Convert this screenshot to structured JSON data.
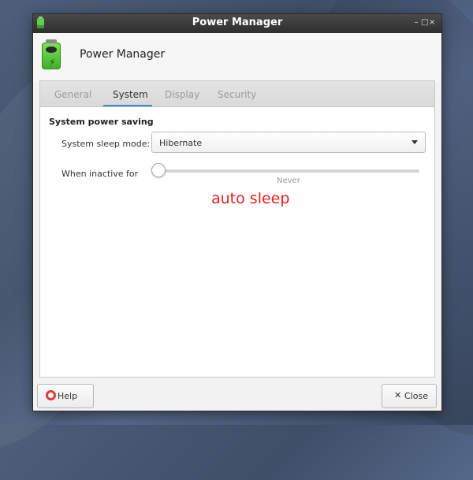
{
  "window": {
    "title": "Power Manager",
    "controls": {
      "minimize": "–",
      "maximize": "□",
      "close": "×"
    }
  },
  "header": {
    "app_title": "Power Manager",
    "app_icon": "battery-icon"
  },
  "tabs": [
    {
      "label": "General",
      "active": false
    },
    {
      "label": "System",
      "active": true
    },
    {
      "label": "Display",
      "active": false
    },
    {
      "label": "Security",
      "active": false
    }
  ],
  "system": {
    "section_title": "System power saving",
    "sleep_mode_label": "System sleep mode:",
    "sleep_mode_value": "Hibernate",
    "inactive_label": "When inactive for",
    "inactive_value": "Never",
    "inactive_slider_fraction": 0.0
  },
  "annotation": {
    "text": "auto sleep",
    "color": "#e81c1c"
  },
  "buttons": {
    "help": "Help",
    "close": "Close"
  },
  "colors": {
    "accent": "#3c88d6",
    "titlebar": "#333333"
  }
}
